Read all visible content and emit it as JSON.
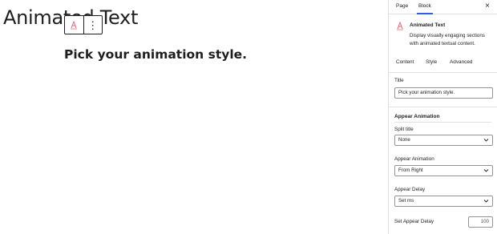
{
  "canvas": {
    "heading": "Animated Text",
    "block_text": "Pick your animation style.",
    "toolbar": {
      "block_icon": "animated-text-icon",
      "more_label": "⋮"
    }
  },
  "sidebar": {
    "tabs": [
      {
        "label": "Page"
      },
      {
        "label": "Block"
      }
    ],
    "close_label": "×",
    "block": {
      "icon": "animated-text-icon",
      "title": "Animated Text",
      "description": "Display visually engaging sections with animated textual content."
    },
    "sub_tabs": [
      {
        "label": "Content"
      },
      {
        "label": "Style"
      },
      {
        "label": "Advanced"
      }
    ],
    "title_field": {
      "label": "Title",
      "value": "Pick your animation style."
    },
    "appear_section": {
      "title": "Appear Animation",
      "split_title": {
        "label": "Split title",
        "value": "None"
      },
      "appear_animation": {
        "label": "Appear Animation",
        "value": "From Right"
      },
      "appear_delay": {
        "label": "Appear Delay",
        "value": "Set ms"
      },
      "set_appear_delay": {
        "label": "Set Appear Delay",
        "value": "100"
      }
    }
  },
  "colors": {
    "accent": "#3858e9",
    "icon": "#e2687a",
    "border": "#949494"
  }
}
